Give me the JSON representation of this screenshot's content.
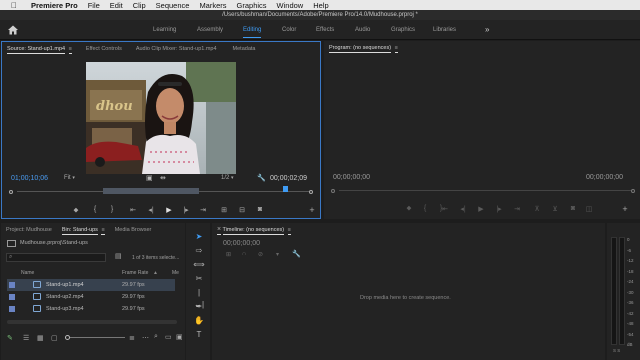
{
  "menubar": {
    "app": "Premiere Pro",
    "items": [
      "File",
      "Edit",
      "Clip",
      "Sequence",
      "Markers",
      "Graphics",
      "Window",
      "Help"
    ]
  },
  "title_path": "/Users/bushman/Documents/Adobe/Premiere Pro/14.0/Mudhouse.prproj *",
  "workspaces": [
    "Learning",
    "Assembly",
    "Editing",
    "Color",
    "Effects",
    "Audio",
    "Graphics",
    "Libraries"
  ],
  "workspaces_more": "»",
  "source_tabs": [
    "Source: Stand-up1.mp4",
    "Effect Controls",
    "Audio Clip Mixer: Stand-up1.mp4",
    "Metadata"
  ],
  "source": {
    "timecode_current": "01;00;10;06",
    "fit_label": "Fit",
    "resolution": "1/2",
    "duration": "00;00;02;09"
  },
  "program_tab": "Program: (no sequences)",
  "program": {
    "timecode_left": "00;00;00;00",
    "timecode_right": "00;00;00;00"
  },
  "project_tabs": [
    "Project: Mudhouse",
    "Bin: Stand-ups",
    "Media Browser"
  ],
  "project": {
    "path": "Mudhouse.prproj\\Stand-ups",
    "search_placeholder": "",
    "selection_count": "1 of 3 items selecte...",
    "columns": [
      "Name",
      "Frame Rate",
      "Me"
    ],
    "rows": [
      {
        "name": "Stand-up1.mp4",
        "fps": "29.97 fps"
      },
      {
        "name": "Stand-up2.mp4",
        "fps": "29.97 fps"
      },
      {
        "name": "Stand-up3.mp4",
        "fps": "29.97 fps"
      }
    ]
  },
  "timeline": {
    "tab": "Timeline: (no sequences)",
    "timecode": "00;00;00;00",
    "empty_message": "Drop media here to create sequence."
  },
  "meter_labels": [
    "0",
    "-6",
    "-12",
    "-18",
    "-24",
    "-30",
    "-36",
    "-42",
    "-48",
    "-54",
    "dB"
  ],
  "meter_bottom": "S S",
  "colors": {
    "accent": "#3f9cf4",
    "panel_bg": "#232323",
    "active_border": "#3a78c6"
  }
}
